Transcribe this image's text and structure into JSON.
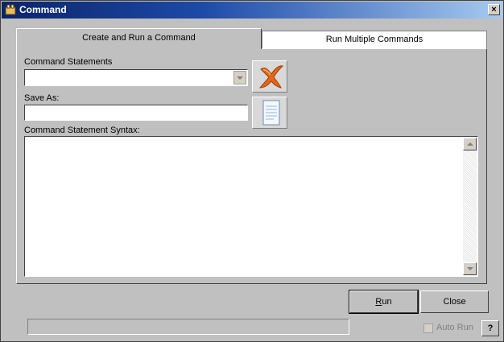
{
  "window": {
    "title": "Command",
    "close_glyph": "×"
  },
  "tabs": [
    {
      "label": "Create and Run a Command",
      "active": true
    },
    {
      "label": "Run Multiple Commands",
      "active": false
    }
  ],
  "form": {
    "statements_label": "Command Statements",
    "statements_value": "",
    "save_as_label": "Save As:",
    "save_as_value": "",
    "syntax_label": "Command Statement Syntax:",
    "syntax_value": ""
  },
  "icons": {
    "delete": "x-delete-icon",
    "new": "document-icon"
  },
  "buttons": {
    "run_access": "R",
    "run_rest": "un",
    "close": "Close",
    "help": "?"
  },
  "auto_run": {
    "label": "Auto Run",
    "checked": false
  },
  "colors": {
    "titlebar_start": "#0a246a",
    "titlebar_end": "#a6caf0",
    "window_bg": "#c0c0c0",
    "delete_icon": "#e0661a"
  }
}
